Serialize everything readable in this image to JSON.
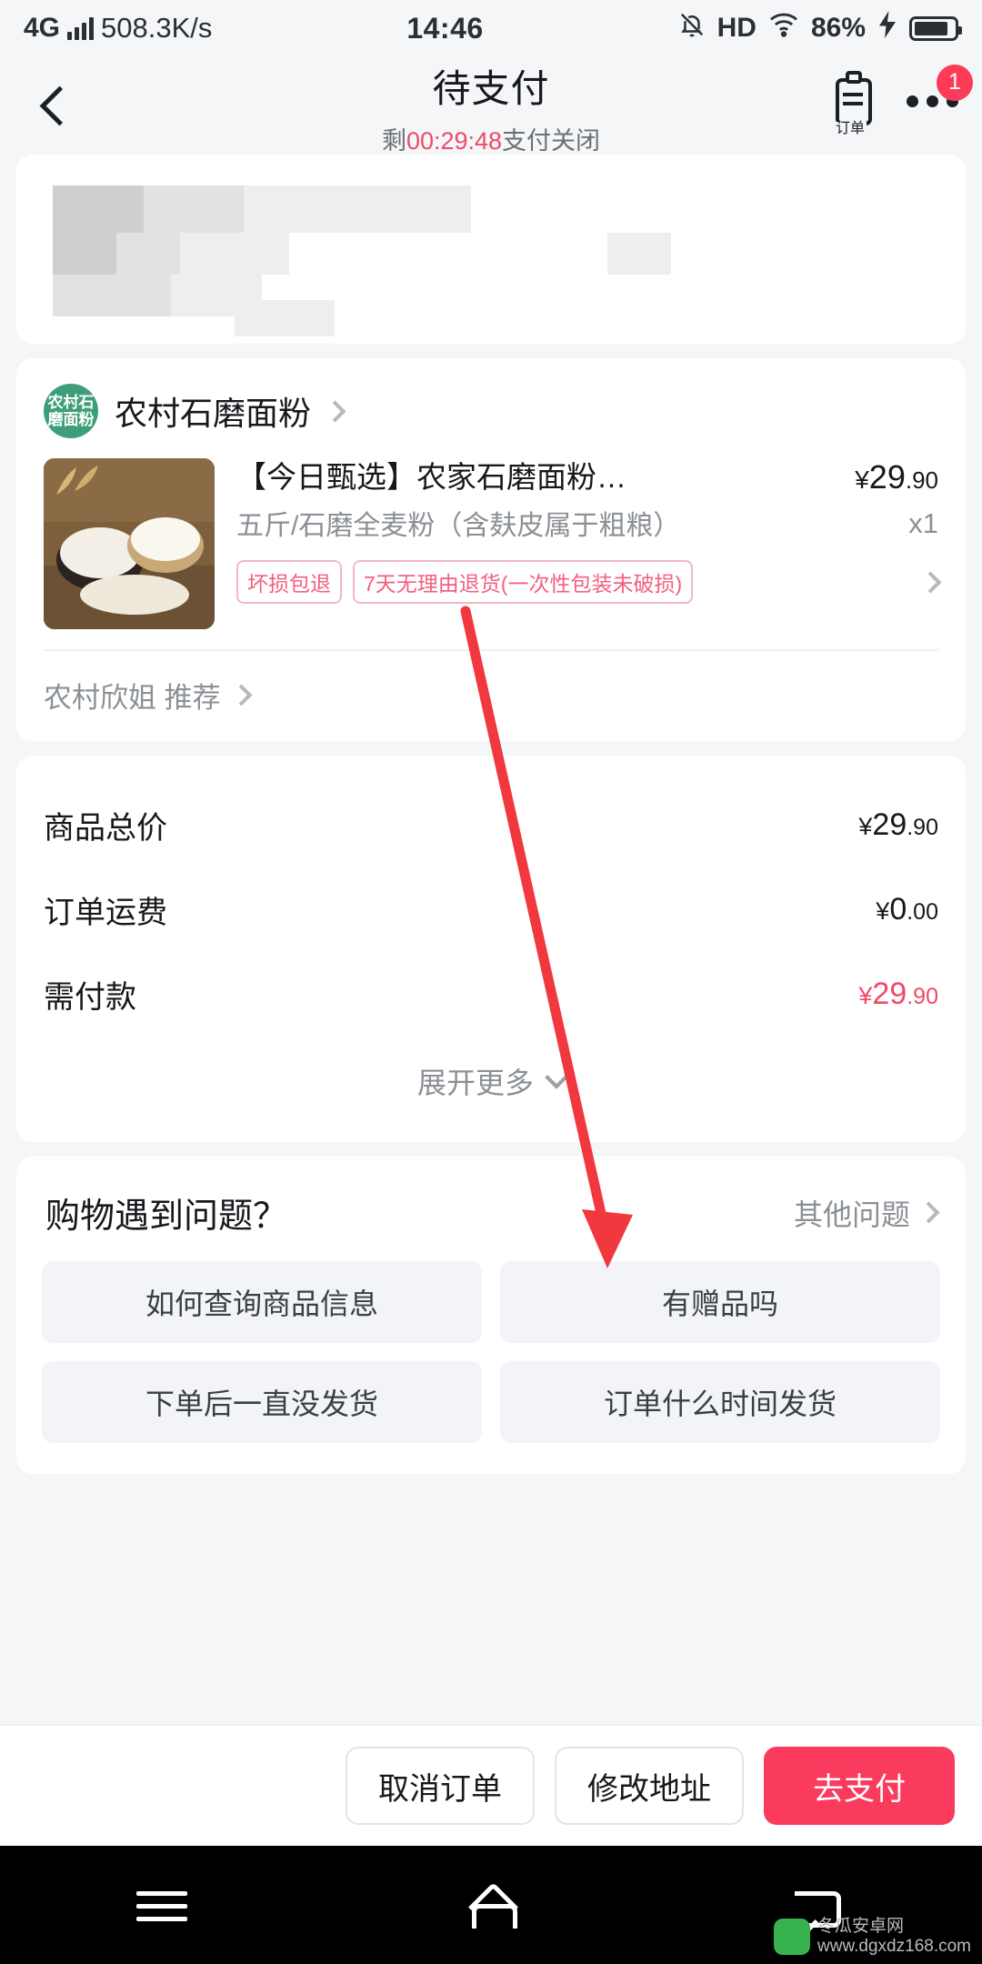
{
  "statusbar": {
    "network_type": "4G",
    "net_speed": "508.3K/s",
    "time": "14:46",
    "hd_label": "HD",
    "battery_percent": "86%",
    "signal_icon": "signal-bars-icon",
    "mute_icon": "bell-muted-icon",
    "wifi_icon": "wifi-icon",
    "charging_icon": "charging-bolt-icon",
    "battery_icon": "battery-icon"
  },
  "header": {
    "back_icon": "back-chevron-icon",
    "title": "待支付",
    "countdown_prefix": "剩",
    "countdown": "00:29:48",
    "countdown_suffix": "支付关闭",
    "order_icon": "order-clipboard-icon",
    "order_icon_caption": "订单",
    "more_icon": "more-dots-icon",
    "badge_count": "1",
    "badge_color": "#fb3b57",
    "countdown_color": "#ef4a67"
  },
  "address_card": {
    "redacted": true,
    "note": "blurred address block"
  },
  "shop": {
    "avatar_text_line1": "农村石",
    "avatar_text_line2": "磨面粉",
    "avatar_color": "#3e9e79",
    "name": "农村石磨面粉",
    "chevron_icon": "chevron-right-icon"
  },
  "product": {
    "image_alt": "石磨面粉 product photo",
    "title": "【今日甄选】农家石磨面粉…",
    "price_currency": "¥",
    "price_int": "29",
    "price_dec": ".90",
    "spec": "五斤/石磨全麦粉（含麸皮属于粗粮）",
    "quantity": "x1",
    "tags": [
      "坏损包退",
      "7天无理由退货(一次性包装未破损)"
    ],
    "tag_color": "#f2607f",
    "tag_border_color": "#f3b8c3",
    "detail_chevron_icon": "chevron-right-icon"
  },
  "recommend": {
    "text": "农村欣姐 推荐",
    "chevron_icon": "chevron-right-icon"
  },
  "summary": {
    "rows": [
      {
        "label": "商品总价",
        "currency": "¥",
        "int": "29",
        "dec": ".90",
        "highlight": false
      },
      {
        "label": "订单运费",
        "currency": "¥",
        "int": "0",
        "dec": ".00",
        "highlight": false
      },
      {
        "label": "需付款",
        "currency": "¥",
        "int": "29",
        "dec": ".90",
        "highlight": true
      }
    ],
    "expand_label": "展开更多",
    "expand_icon": "chevron-down-icon",
    "highlight_color": "#ef4a67"
  },
  "faq": {
    "title": "购物遇到问题？",
    "more_label": "其他问题",
    "more_icon": "chevron-right-icon",
    "chips": [
      "如何查询商品信息",
      "有赠品吗",
      "下单后一直没发货",
      "订单什么时间发货"
    ]
  },
  "actionbar": {
    "cancel_label": "取消订单",
    "edit_address_label": "修改地址",
    "pay_label": "去支付",
    "pay_color": "#fb3b5e"
  },
  "navbar": {
    "menu_icon": "menu-icon",
    "home_icon": "home-icon",
    "back_icon": "back-icon"
  },
  "watermark": {
    "line1": "冬瓜安卓网",
    "line2": "www.dgxdz168.com"
  },
  "annotation": {
    "arrow_color": "#f0383e",
    "description": "red arrow pointing to 去支付 button"
  }
}
